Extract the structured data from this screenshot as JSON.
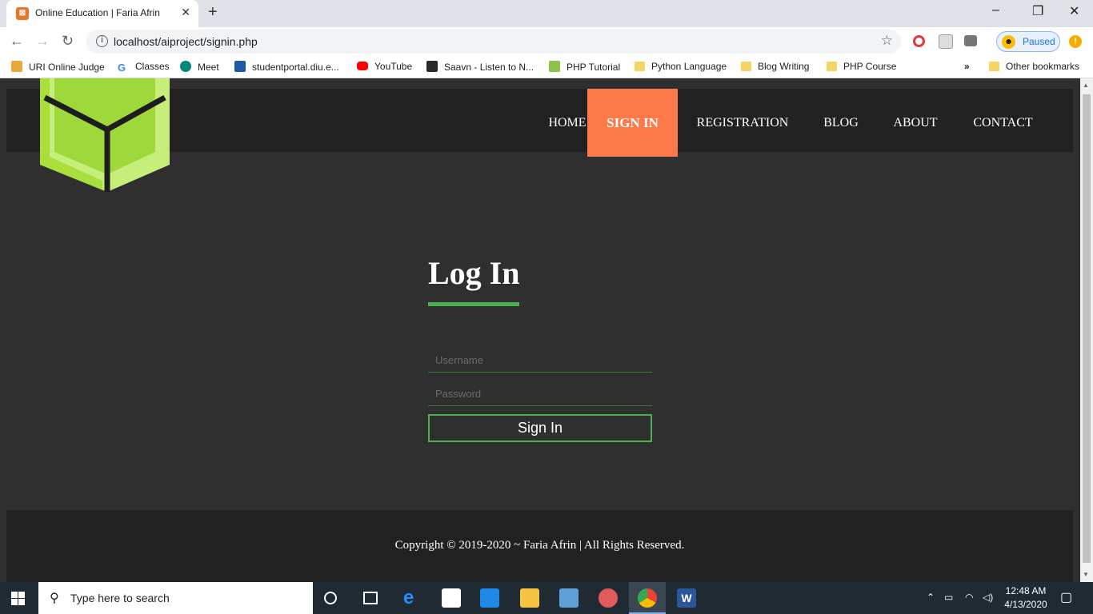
{
  "browser": {
    "tab_title": "Online Education | Faria Afrin",
    "url": "localhost/aiproject/signin.php",
    "profile_status": "Paused",
    "bookmarks": [
      "URI Online Judge",
      "Classes",
      "Meet",
      "studentportal.diu.e...",
      "YouTube",
      "Saavn - Listen to N...",
      "PHP Tutorial",
      "Python Language",
      "Blog Writing",
      "PHP Course"
    ],
    "overflow": "»",
    "other_bookmarks": "Other bookmarks"
  },
  "nav": {
    "items": [
      "HOME",
      "SIGN IN",
      "REGISTRATION",
      "BLOG",
      "ABOUT",
      "CONTACT"
    ],
    "active": "SIGN IN",
    "active_color": "#ff7a4a"
  },
  "login": {
    "title": "Log In",
    "username_placeholder": "Username",
    "password_placeholder": "Password",
    "submit_label": "Sign In",
    "accent_color": "#4caf50"
  },
  "footer": {
    "copyright": "Copyright © 2019-2020 ~ Faria Afrin | All Rights Reserved."
  },
  "taskbar": {
    "search_placeholder": "Type here to search",
    "time": "12:48 AM",
    "date": "4/13/2020"
  }
}
